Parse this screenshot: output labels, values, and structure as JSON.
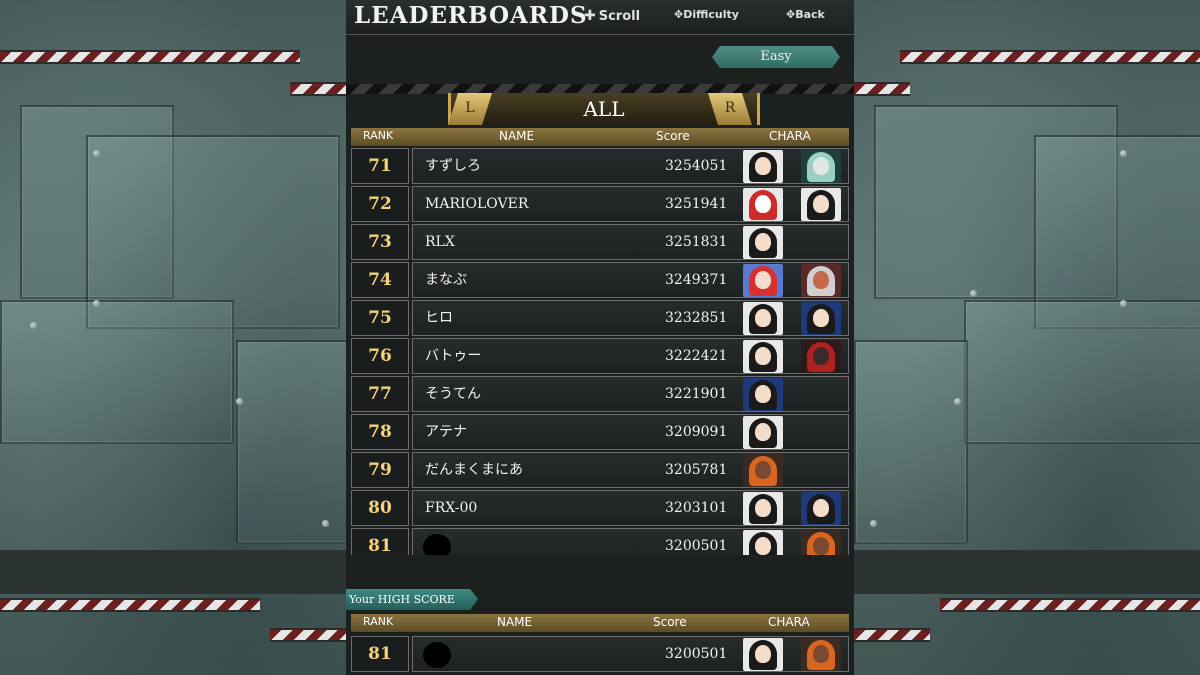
{
  "header": {
    "title": "LEADERBOARDS",
    "hints": {
      "scroll": "Scroll",
      "difficulty": "Difficulty",
      "back": "Back"
    }
  },
  "difficulty": {
    "selected": "Easy"
  },
  "filter": {
    "left_button": "L",
    "label": "ALL",
    "right_button": "R"
  },
  "columns": {
    "rank": "RANK",
    "name": "NAME",
    "score": "Score",
    "chara": "CHARA"
  },
  "rows": [
    {
      "rank": "71",
      "name": "すずしろ",
      "score": "3254051"
    },
    {
      "rank": "72",
      "name": "MARIOLOVER",
      "score": "3251941"
    },
    {
      "rank": "73",
      "name": "RLX",
      "score": "3251831"
    },
    {
      "rank": "74",
      "name": "まなぶ",
      "score": "3249371"
    },
    {
      "rank": "75",
      "name": "ヒロ",
      "score": "3232851"
    },
    {
      "rank": "76",
      "name": "バトゥー",
      "score": "3222421"
    },
    {
      "rank": "77",
      "name": "そうてん",
      "score": "3221901"
    },
    {
      "rank": "78",
      "name": "アテナ",
      "score": "3209091"
    },
    {
      "rank": "79",
      "name": "だんまくまにあ",
      "score": "3205781"
    },
    {
      "rank": "80",
      "name": "FRX-00",
      "score": "3203101"
    },
    {
      "rank": "81",
      "name": "",
      "score": "3200501"
    }
  ],
  "your_high_score": {
    "label": "Your HIGH SCORE",
    "rank": "81",
    "name": "",
    "score": "3200501"
  },
  "icons": {
    "scroll": "dpad-scroll-icon",
    "difficulty": "dpad-left-right-icon",
    "back": "dpad-back-icon",
    "character": "character-portrait-icon",
    "redaction": "redacted-avatar-icon"
  },
  "colors": {
    "rank_text": "#f3d27a",
    "easy_tab": "#2f6c64",
    "gold": "#c9a94e"
  }
}
